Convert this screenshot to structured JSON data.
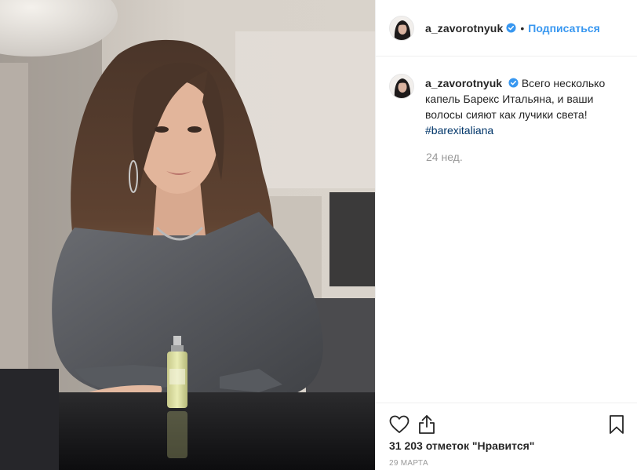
{
  "post": {
    "author": {
      "username": "a_zavorotnyuk",
      "verified": true,
      "avatar_icon": "avatar-woman-dark-hair"
    },
    "header": {
      "separator": "•",
      "follow_label": "Подписаться"
    },
    "caption": {
      "username": "a_zavorotnyuk",
      "text": "Всего несколько капель Барекс Итальяна, и ваши волосы сияют как лучики света!",
      "hashtag": "#barexitaliana"
    },
    "time_ago": "24 нед.",
    "actions": {
      "like_icon": "heart-icon",
      "share_icon": "share-icon",
      "save_icon": "bookmark-icon"
    },
    "likes_text": "31 203 отметок \"Нравится\"",
    "date_text": "29 марта"
  },
  "colors": {
    "link_blue": "#3897f0",
    "hashtag_blue": "#003569",
    "muted_gray": "#999999",
    "text": "#262626",
    "border": "#efefef"
  }
}
